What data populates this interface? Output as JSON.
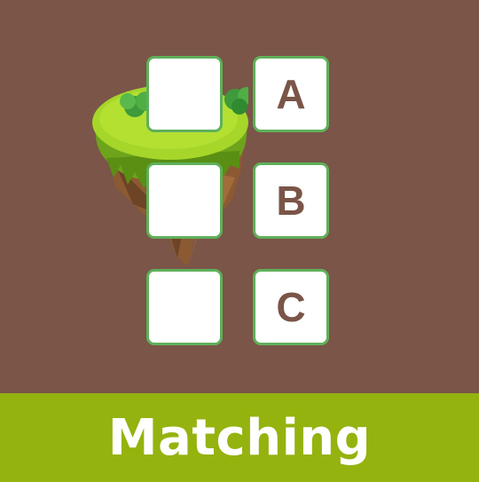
{
  "game": {
    "title": "Matching",
    "left_tiles": [
      "",
      "",
      ""
    ],
    "right_tiles": [
      "A",
      "B",
      "C"
    ]
  },
  "colors": {
    "background": "#7a5548",
    "footer": "#94b30f",
    "tile_border": "#5fb05a",
    "letter": "#7a5548"
  },
  "decoration": {
    "island_icon": "floating-grass-island-icon"
  }
}
